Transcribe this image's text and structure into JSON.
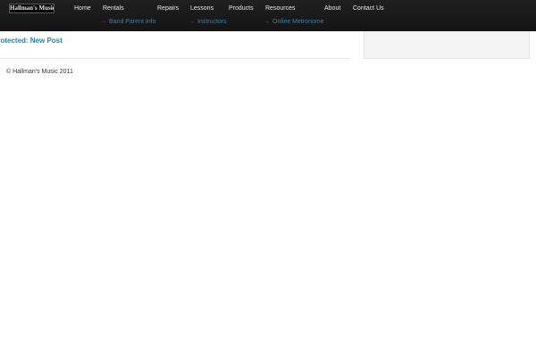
{
  "header": {
    "logo_text": "Hallman's Music",
    "nav": [
      {
        "label": "Home"
      },
      {
        "label": "Rentals",
        "sub": "Band Parent Info"
      },
      {
        "label": "Repairs"
      },
      {
        "label": "Lessons",
        "sub": "Instructors"
      },
      {
        "label": "Products"
      },
      {
        "label": "Resources",
        "sub": "Online Metronome"
      },
      {
        "label": "About"
      },
      {
        "label": "Contact Us"
      }
    ],
    "sub_arrow": "→"
  },
  "main": {
    "post_title": "Protected: New Post"
  },
  "footer": {
    "copyright": "© Hallman's Music 2011"
  },
  "colors": {
    "topbar": "#1a1a1a",
    "link": "#1f86b6",
    "nav_text": "#e6e6e6"
  }
}
